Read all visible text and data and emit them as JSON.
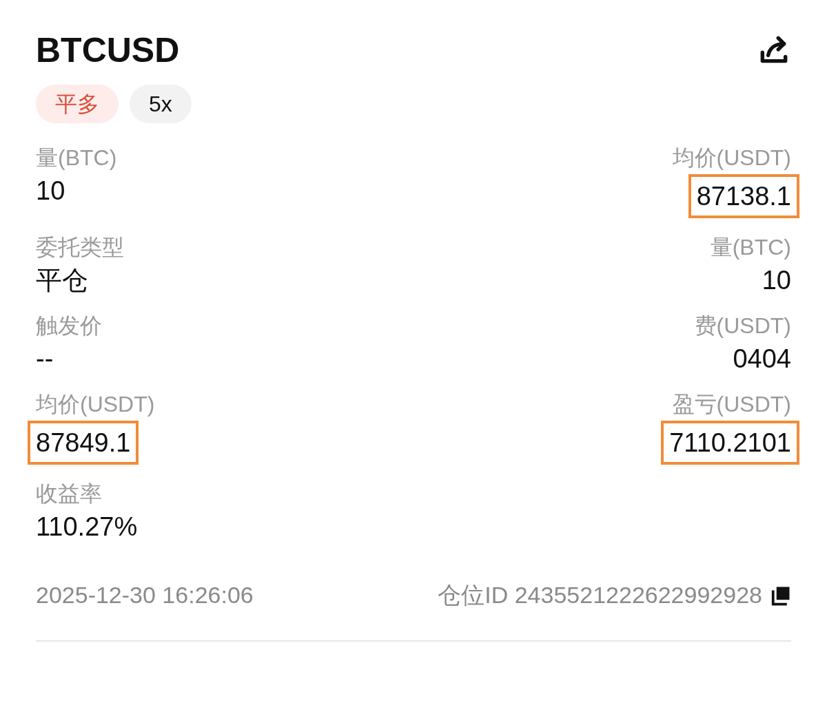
{
  "title": "BTCUSD",
  "badges": [
    {
      "label": "平多",
      "kind": "side"
    },
    {
      "label": "5x",
      "kind": "mode"
    }
  ],
  "rows": [
    {
      "left": {
        "label": "量(BTC)",
        "value": "10",
        "highlighted": false
      },
      "right": {
        "label": "均价(USDT)",
        "value": "87138.1",
        "highlighted": true
      }
    },
    {
      "left": {
        "label": "委托类型",
        "value": "平仓",
        "highlighted": false
      },
      "right": {
        "label": "量(BTC)",
        "value": "10",
        "highlighted": false
      }
    },
    {
      "left": {
        "label": "触发价",
        "value": "--",
        "highlighted": false
      },
      "right": {
        "label": "费(USDT)",
        "value": "0404",
        "highlighted": false
      }
    },
    {
      "left": {
        "label": "均价(USDT)",
        "value": "87849.1",
        "highlighted": true
      },
      "right": {
        "label": "盈亏(USDT)",
        "value": "7110.2101",
        "highlighted": true
      }
    },
    {
      "left": {
        "label": "收益率",
        "value": "110.27%",
        "highlighted": false
      }
    }
  ],
  "footer": {
    "time": "2025-12-30 16:26:06",
    "position_id": "仓位ID 2435521222622992928"
  }
}
